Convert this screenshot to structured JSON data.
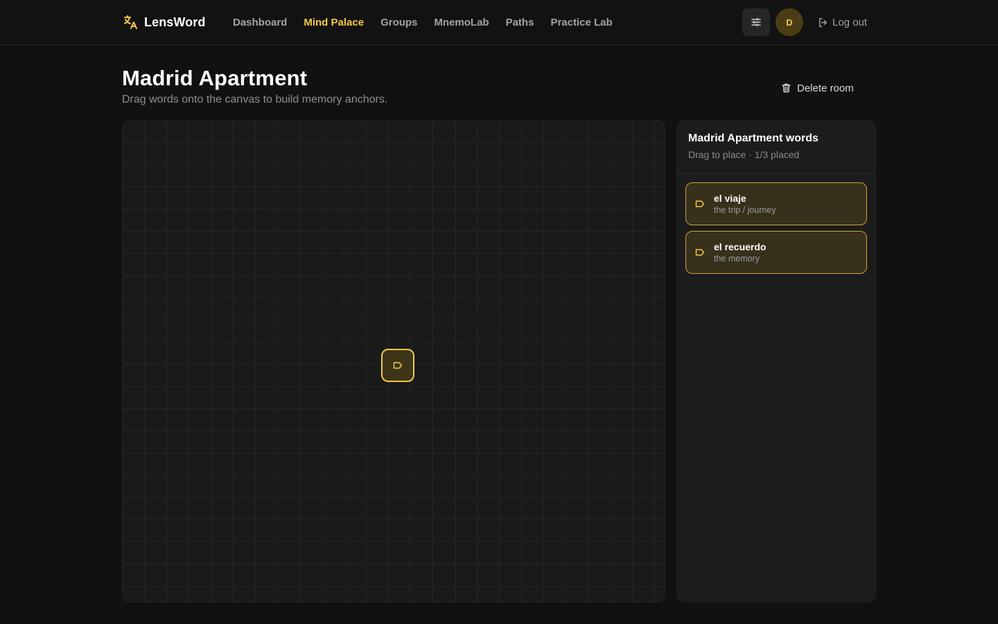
{
  "brand": {
    "name": "LensWord",
    "icon": "translate-icon"
  },
  "nav": {
    "items": [
      {
        "label": "Dashboard",
        "active": false
      },
      {
        "label": "Mind Palace",
        "active": true
      },
      {
        "label": "Groups",
        "active": false
      },
      {
        "label": "MnemoLab",
        "active": false
      },
      {
        "label": "Paths",
        "active": false
      },
      {
        "label": "Practice Lab",
        "active": false
      }
    ]
  },
  "user": {
    "initial": "D",
    "settings_icon": "sliders-icon"
  },
  "logout": {
    "label": "Log out",
    "icon": "logout-icon"
  },
  "page": {
    "title": "Madrid Apartment",
    "subtitle": "Drag words onto the canvas to build memory anchors.",
    "delete_label": "Delete room",
    "delete_icon": "trash-icon"
  },
  "canvas": {
    "anchors": [
      {
        "icon": "tag-icon"
      }
    ]
  },
  "panel": {
    "title": "Madrid Apartment words",
    "subtitle": "Drag to place · 1/3 placed",
    "words": [
      {
        "term": "el viaje",
        "translation": "the trip / journey",
        "icon": "tag-icon"
      },
      {
        "term": "el recuerdo",
        "translation": "the memory",
        "icon": "tag-icon"
      }
    ]
  },
  "colors": {
    "accent": "#f5c842",
    "background": "#111111",
    "panel": "#1c1c1c",
    "card": "#37311c"
  }
}
